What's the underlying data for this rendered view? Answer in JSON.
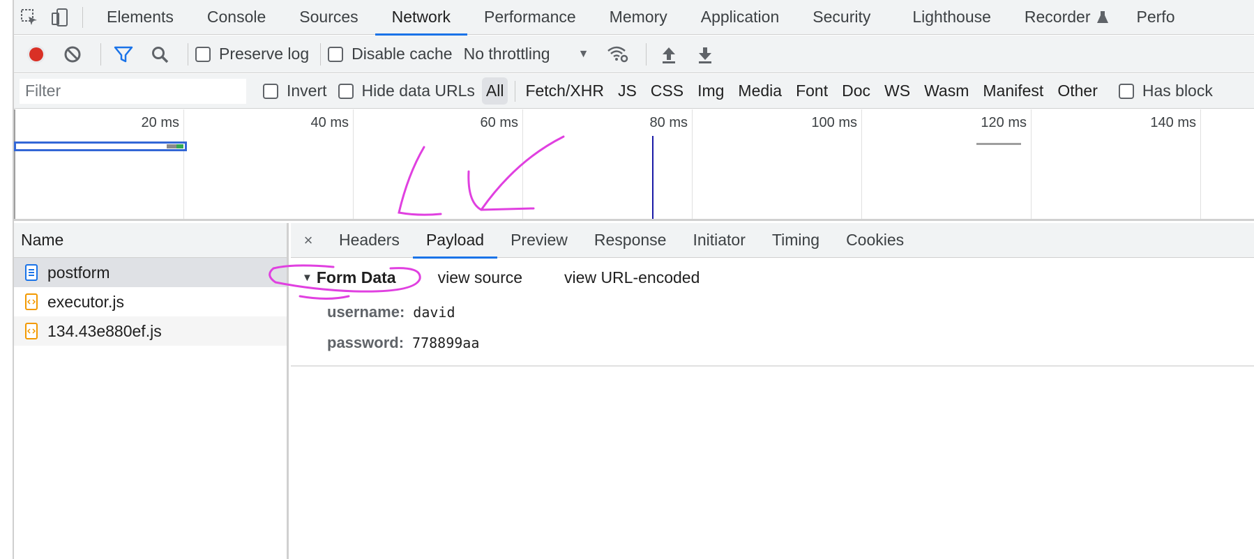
{
  "main_tabs": [
    "Elements",
    "Console",
    "Sources",
    "Network",
    "Performance",
    "Memory",
    "Application",
    "Security",
    "Lighthouse",
    "Recorder",
    "Perfo"
  ],
  "active_main_tab": "Network",
  "toolbar": {
    "preserve_log": "Preserve log",
    "disable_cache": "Disable cache",
    "throttling": "No throttling"
  },
  "filterbar": {
    "filter_placeholder": "Filter",
    "invert": "Invert",
    "hide_data_urls": "Hide data URLs",
    "types": [
      "All",
      "Fetch/XHR",
      "JS",
      "CSS",
      "Img",
      "Media",
      "Font",
      "Doc",
      "WS",
      "Wasm",
      "Manifest",
      "Other"
    ],
    "has_blocked": "Has block"
  },
  "timeline": {
    "ticks": [
      "20 ms",
      "40 ms",
      "60 ms",
      "80 ms",
      "100 ms",
      "120 ms",
      "140 ms"
    ]
  },
  "name_panel": {
    "header": "Name",
    "rows": [
      {
        "name": "postform",
        "type": "document"
      },
      {
        "name": "executor.js",
        "type": "script"
      },
      {
        "name": "134.43e880ef.js",
        "type": "script"
      }
    ]
  },
  "details": {
    "close": "×",
    "tabs": [
      "Headers",
      "Payload",
      "Preview",
      "Response",
      "Initiator",
      "Timing",
      "Cookies"
    ],
    "active_tab": "Payload",
    "form_data": {
      "title": "Form Data",
      "view_source": "view source",
      "view_url_encoded": "view URL-encoded",
      "fields": [
        {
          "key": "username:",
          "value": "david"
        },
        {
          "key": "password:",
          "value": "778899aa"
        }
      ]
    }
  },
  "colors": {
    "accent": "#1a73e8",
    "record": "#d93025",
    "annotation": "#e040e0"
  }
}
